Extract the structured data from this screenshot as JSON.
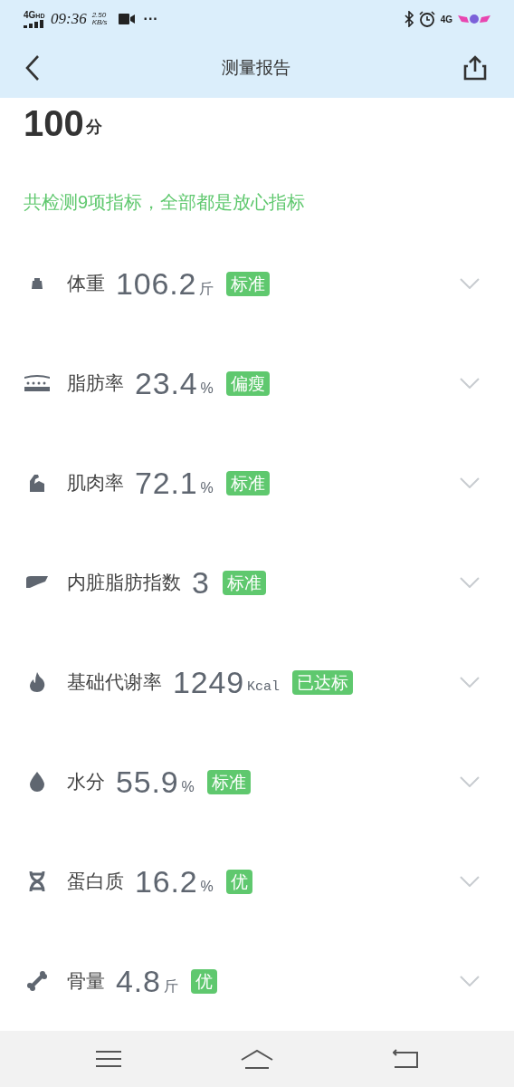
{
  "status_bar": {
    "network": "4G",
    "hd": "HD",
    "time": "09:36",
    "speed": "2.50",
    "speed_unit": "KB/s",
    "more": "···",
    "network_right": "4G"
  },
  "header": {
    "title": "测量报告"
  },
  "score": {
    "value": "100",
    "unit": "分"
  },
  "summary": "共检测9项指标，全部都是放心指标",
  "metrics": [
    {
      "kind": "weight",
      "name": "体重",
      "value": "106.2",
      "unit": "斤",
      "tag": "标准",
      "expanded": false
    },
    {
      "kind": "fat",
      "name": "脂肪率",
      "value": "23.4",
      "unit": "%",
      "tag": "偏瘦",
      "expanded": false
    },
    {
      "kind": "muscle",
      "name": "肌肉率",
      "value": "72.1",
      "unit": "%",
      "tag": "标准",
      "expanded": false
    },
    {
      "kind": "organ",
      "name": "内脏脂肪指数",
      "value": "3",
      "tag": "标准",
      "expanded": false
    },
    {
      "kind": "flame",
      "name": "基础代谢率",
      "value": "1249",
      "unit": "Kcal",
      "tag": "已达标",
      "expanded": false
    },
    {
      "kind": "drop",
      "name": "水分",
      "value": "55.9",
      "unit": "%",
      "tag": "标准",
      "expanded": false
    },
    {
      "kind": "dna",
      "name": "蛋白质",
      "value": "16.2",
      "unit": "%",
      "tag": "优",
      "expanded": false
    },
    {
      "kind": "bone",
      "name": "骨量",
      "value": "4.8",
      "unit": "斤",
      "tag": "优",
      "expanded": false
    }
  ]
}
